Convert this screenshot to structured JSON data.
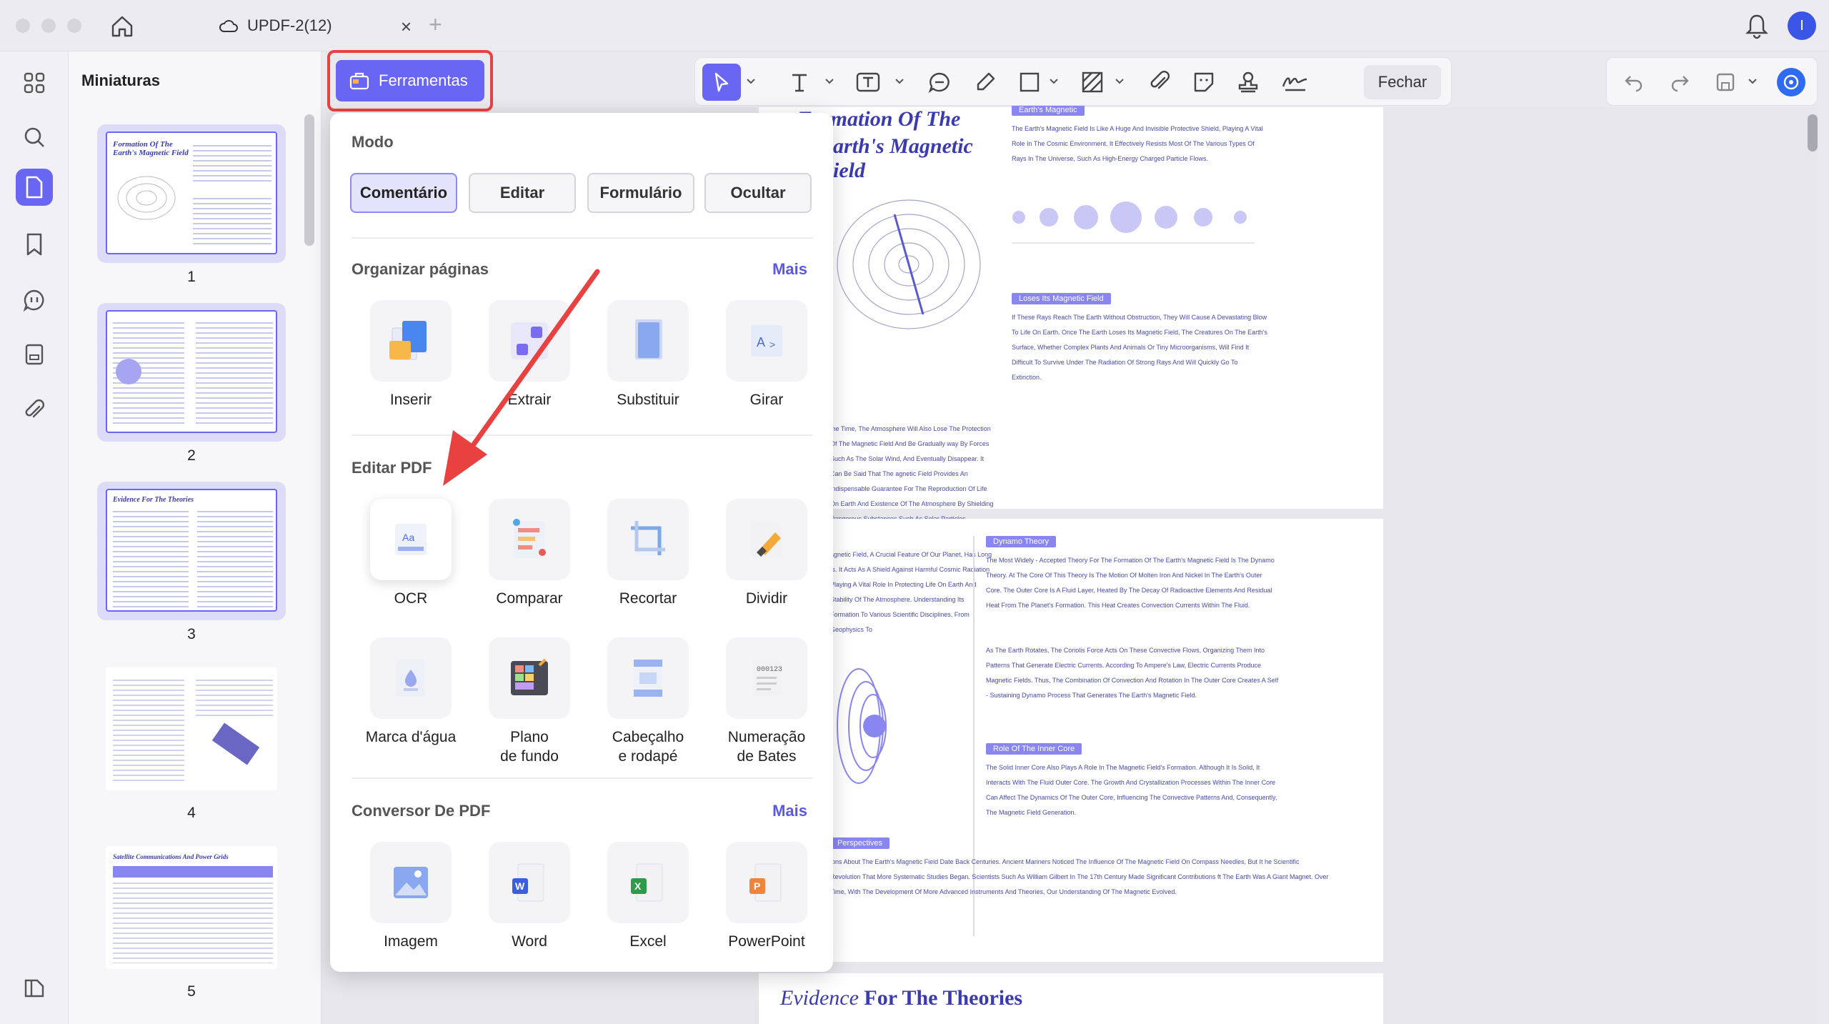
{
  "titlebar": {
    "tab_title": "UPDF-2(12)",
    "avatar_letter": "I"
  },
  "thumbnails": {
    "title": "Miniaturas",
    "pages": [
      "1",
      "2",
      "3",
      "4",
      "5"
    ]
  },
  "toolbar": {
    "tools_label": "Ferramentas",
    "close_label": "Fechar"
  },
  "panel": {
    "mode_title": "Modo",
    "modes": [
      "Comentário",
      "Editar",
      "Formulário",
      "Ocultar"
    ],
    "organize": {
      "title": "Organizar páginas",
      "more": "Mais",
      "items": [
        "Inserir",
        "Extrair",
        "Substituir",
        "Girar"
      ]
    },
    "edit": {
      "title": "Editar PDF",
      "items": [
        "OCR",
        "Comparar",
        "Recortar",
        "Dividir"
      ],
      "items2": [
        "Marca d'água",
        "Plano\nde fundo",
        "Cabeçalho\ne rodapé",
        "Numeração\nde Bates"
      ]
    },
    "converter": {
      "title": "Conversor De PDF",
      "more": "Mais",
      "items": [
        "Imagem",
        "Word",
        "Excel",
        "PowerPoint"
      ]
    }
  },
  "document": {
    "page1_heading_a": "Formation Of The",
    "page1_heading_b": "Earth's Magnetic Field",
    "label_earth": "Earth's Magnetic",
    "para1": "The Earth's Magnetic Field Is Like A Huge And Invisible Protective Shield, Playing A Vital Role In The Cosmic Environment. It Effectively Resists Most Of The Various Types Of Rays In The Universe, Such As High-Energy Charged Particle Flows.",
    "label_loses": "Loses Its Magnetic Field",
    "para2": "If These Rays Reach The Earth Without Obstruction, They Will Cause A Devastating Blow To Life On Earth. Once The Earth Loses Its Magnetic Field, The Creatures On The Earth's Surface, Whether Complex Plants And Animals Or Tiny Microorganisms, Will Find It Difficult To Survive Under The Radiation Of Strong Rays And Will Quickly Go To Extinction.",
    "label_dynamo": "Dynamo Theory",
    "para3": "The Most Widely - Accepted Theory For The Formation Of The Earth's Magnetic Field Is The Dynamo Theory. At The Core Of This Theory Is The Motion Of Molten Iron And Nickel In The Earth's Outer Core. The Outer Core Is A Fluid Layer, Heated By The Decay Of Radioactive Elements And Residual Heat From The Planet's Formation. This Heat Creates Convection Currents Within The Fluid.",
    "para3b": "As The Earth Rotates, The Coriolis Force Acts On These Convective Flows, Organizing Them Into Patterns That Generate Electric Currents. According To Ampere's Law, Electric Currents Produce Magnetic Fields. Thus, The Combination Of Convection And Rotation In The Outer Core Creates A Self - Sustaining Dynamo Process That Generates The Earth's Magnetic Field.",
    "label_inner": "Role Of The Inner Core",
    "para4": "The Solid Inner Core Also Plays A Role In The Magnetic Field's Formation. Although It Is Solid, It Interacts With The Fluid Outer Core. The Growth And Crystallization Processes Within The Inner Core Can Affect The Dynamics Of The Outer Core, Influencing The Convective Patterns And, Consequently, The Magnetic Field Generation.",
    "label_persp": "Perspectives",
    "para5": "ions About The Earth's Magnetic Field Date Back Centuries. Ancient Mariners Noticed The Influence Of The Magnetic Field On Compass Needles, But It he Scientific Revolution That More Systematic Studies Began. Scientists Such As William Gilbert In The 17th Century Made Significant Contributions ft The Earth Was A Giant Magnet. Over Time, With The Development Of More Advanced Instruments And Theories, Our Understanding Of The Magnetic Evolved.",
    "para_left1": "me Time, The Atmosphere Will Also Lose The Protection Of The Magnetic Field And Be Gradually way By Forces Such As The Solar Wind, And Eventually Disappear. It Can Be Said That The agnetic Field Provides An Indispensable Guarantee For The Reproduction Of Life On Earth And Existence Of The Atmosphere By Shielding Dangerous Substances Such As Solar Particles.",
    "para_left2": "agnetic Field, A Crucial Feature Of Our Planet, Has Long ts. It Acts As A Shield Against Harmful Cosmic Radiation Playing A Vital Role In Protecting Life On Earth And Stability Of The Atmosphere. Understanding Its Formation To Various Scientific Disciplines, From Geophysics To",
    "page_bottom_heading_a": "Evidence",
    "page_bottom_heading_b": "For The Theories"
  }
}
